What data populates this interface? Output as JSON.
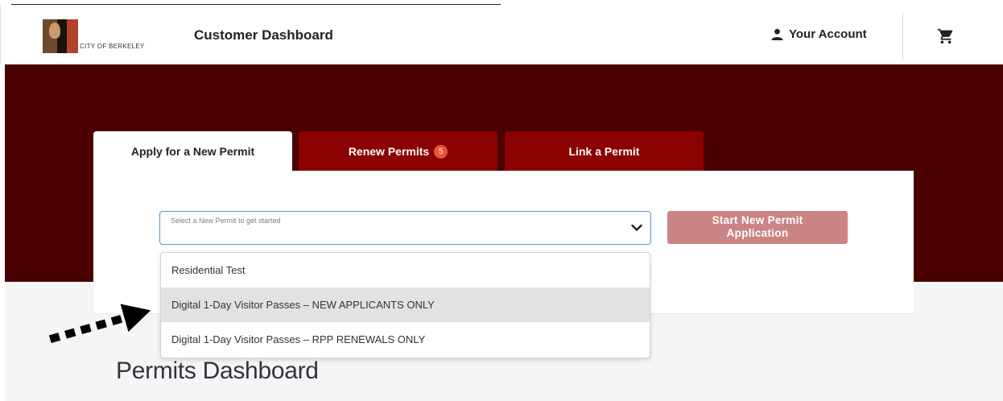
{
  "header": {
    "logo_vertical_text": "BERKELEY",
    "city_text": "CITY OF BERKELEY",
    "title": "Customer Dashboard",
    "account_label": "Your Account"
  },
  "tabs": [
    {
      "label": "Apply for a New Permit",
      "active": true
    },
    {
      "label": "Renew Permits",
      "badge": "5",
      "active": false
    },
    {
      "label": "Link a Permit",
      "active": false
    }
  ],
  "permit_select": {
    "placeholder": "Select a New Permit to get started",
    "options": [
      "Residential Test",
      "Digital 1-Day Visitor Passes – NEW APPLICANTS ONLY",
      "Digital 1-Day Visitor Passes – RPP RENEWALS ONLY"
    ],
    "highlighted_index": 1
  },
  "start_button": {
    "line1": "Start New Permit",
    "line2": "Application"
  },
  "permits_dashboard_title": "Permits Dashboard",
  "icons": [
    "user-icon",
    "cart-icon",
    "chevron-down-icon",
    "dotted-arrow-icon"
  ],
  "colors": {
    "hero": "#4a0000",
    "tab_inactive": "#8b0000",
    "badge": "#e8543b",
    "button_disabled": "#cb8484",
    "select_border": "#5b8fd1",
    "highlight": "#e2e2e2"
  }
}
